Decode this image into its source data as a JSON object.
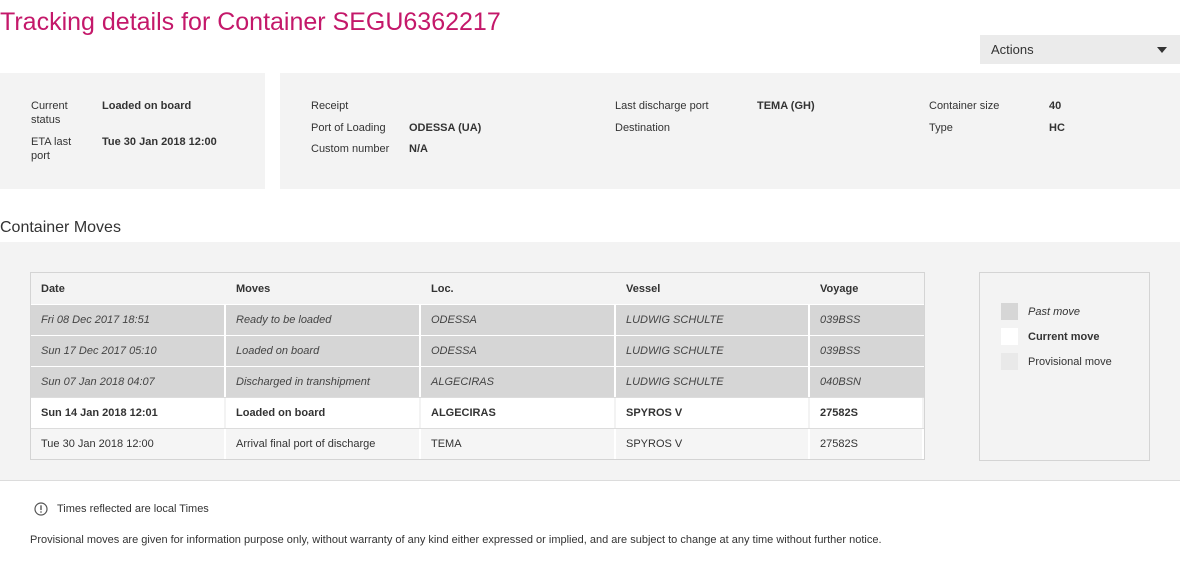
{
  "page": {
    "title": "Tracking details for Container SEGU6362217"
  },
  "actions": {
    "label": "Actions"
  },
  "summary": {
    "current_status_label": "Current status",
    "current_status_value": "Loaded on board",
    "eta_label": "ETA last port",
    "eta_value": "Tue 30 Jan 2018 12:00",
    "receipt_label": "Receipt",
    "receipt_value": "",
    "port_loading_label": "Port of Loading",
    "port_loading_value": "ODESSA (UA)",
    "custom_number_label": "Custom number",
    "custom_number_value": "N/A",
    "last_discharge_label": "Last discharge port",
    "last_discharge_value": "TEMA (GH)",
    "destination_label": "Destination",
    "destination_value": "",
    "container_size_label": "Container size",
    "container_size_value": "40",
    "type_label": "Type",
    "type_value": "HC"
  },
  "moves": {
    "section_title": "Container Moves",
    "columns": [
      "Date",
      "Moves",
      "Loc.",
      "Vessel",
      "Voyage"
    ],
    "rows": [
      {
        "date": "Fri 08 Dec 2017 18:51",
        "move": "Ready to be loaded",
        "loc": "ODESSA",
        "vessel": "LUDWIG SCHULTE",
        "voyage": "039BSS",
        "status": "past"
      },
      {
        "date": "Sun 17 Dec 2017 05:10",
        "move": "Loaded on board",
        "loc": "ODESSA",
        "vessel": "LUDWIG SCHULTE",
        "voyage": "039BSS",
        "status": "past"
      },
      {
        "date": "Sun 07 Jan 2018 04:07",
        "move": "Discharged in transhipment",
        "loc": "ALGECIRAS",
        "vessel": "LUDWIG SCHULTE",
        "voyage": "040BSN",
        "status": "past"
      },
      {
        "date": "Sun 14 Jan 2018 12:01",
        "move": "Loaded on board",
        "loc": "ALGECIRAS",
        "vessel": "SPYROS V",
        "voyage": "27582S",
        "status": "current"
      },
      {
        "date": "Tue 30 Jan 2018 12:00",
        "move": "Arrival final port of discharge",
        "loc": "TEMA",
        "vessel": "SPYROS V",
        "voyage": "27582S",
        "status": "provisional"
      }
    ]
  },
  "legend": {
    "past": "Past move",
    "current": "Current move",
    "provisional": "Provisional move"
  },
  "footer": {
    "times_note": "Times reflected are local Times",
    "disclaimer": "Provisional moves are given for information purpose only, without warranty of any kind either expressed or implied, and are subject to change at any time without further notice."
  },
  "colors": {
    "title": "#c4186a",
    "link": "#2a5ea8",
    "past_row": "#d6d6d6",
    "panel": "#f3f3f3"
  },
  "icons": {
    "actions": "chevron-down-icon",
    "note": "info-icon"
  }
}
